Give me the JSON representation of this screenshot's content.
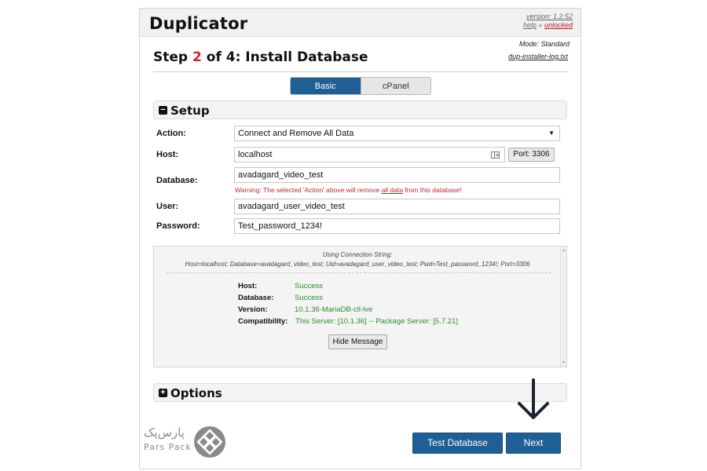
{
  "app": {
    "title": "Duplicator",
    "version": "version: 1.2.52",
    "help": "help",
    "separator": "»",
    "unlocked": "unlocked",
    "mode": "Mode: Standard",
    "log_file": "dup-installer-log.txt"
  },
  "step": {
    "prefix": "Step ",
    "number": "2",
    "suffix": " of 4: Install Database"
  },
  "tabs": [
    {
      "label": "Basic",
      "active": true
    },
    {
      "label": "cPanel",
      "active": false
    }
  ],
  "setup": {
    "heading": "Setup",
    "action_label": "Action:",
    "action_value": "Connect and Remove All Data",
    "host_label": "Host:",
    "host_value": "localhost",
    "port_button": "Port: 3306",
    "database_label": "Database:",
    "database_value": "avadagard_video_test",
    "warning_pre": "Warning: The selected 'Action' above will remove ",
    "warning_link": "all data",
    "warning_post": " from this database!",
    "user_label": "User:",
    "user_value": "avadagard_user_video_test",
    "password_label": "Password:",
    "password_value": "Test_password_1234!"
  },
  "result": {
    "title": "Using Connection String:",
    "connection_string": "Host=localhost; Database=avadagard_video_test; Uid=avadagard_user_video_test; Pwd=Test_password_1234!; Port=3306",
    "rows": [
      {
        "label": "Host:",
        "value": "Success"
      },
      {
        "label": "Database:",
        "value": "Success"
      },
      {
        "label": "Version:",
        "value": "10.1.36-MariaDB-cll-lve"
      },
      {
        "label": "Compatibility:",
        "value": "This Server: [10.1.36] -- Package Server: [5.7.21]"
      }
    ],
    "hide_button": "Hide Message"
  },
  "options": {
    "heading": "Options"
  },
  "buttons": {
    "test_database": "Test Database",
    "next": "Next"
  },
  "watermark": {
    "persian": "پارس‌پک",
    "english": "Pars Pack"
  },
  "colors": {
    "primary": "#1f5f94",
    "step_number": "#c0272d",
    "success": "#2e8b2e",
    "warning": "#c0272d"
  }
}
